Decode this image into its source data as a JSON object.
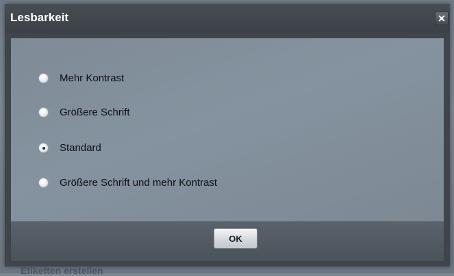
{
  "dialog": {
    "title": "Lesbarkeit",
    "close_label": "✕",
    "options": [
      {
        "label": "Mehr Kontrast",
        "selected": false
      },
      {
        "label": "Größere Schrift",
        "selected": false
      },
      {
        "label": "Standard",
        "selected": true
      },
      {
        "label": "Größere Schrift und mehr Kontrast",
        "selected": false
      }
    ],
    "ok_label": "OK"
  },
  "background": {
    "partial_text": "Etiketten erstellen"
  },
  "colors": {
    "titlebar": "#3f454b",
    "content": "#8390a0",
    "footer": "#4f575f"
  }
}
